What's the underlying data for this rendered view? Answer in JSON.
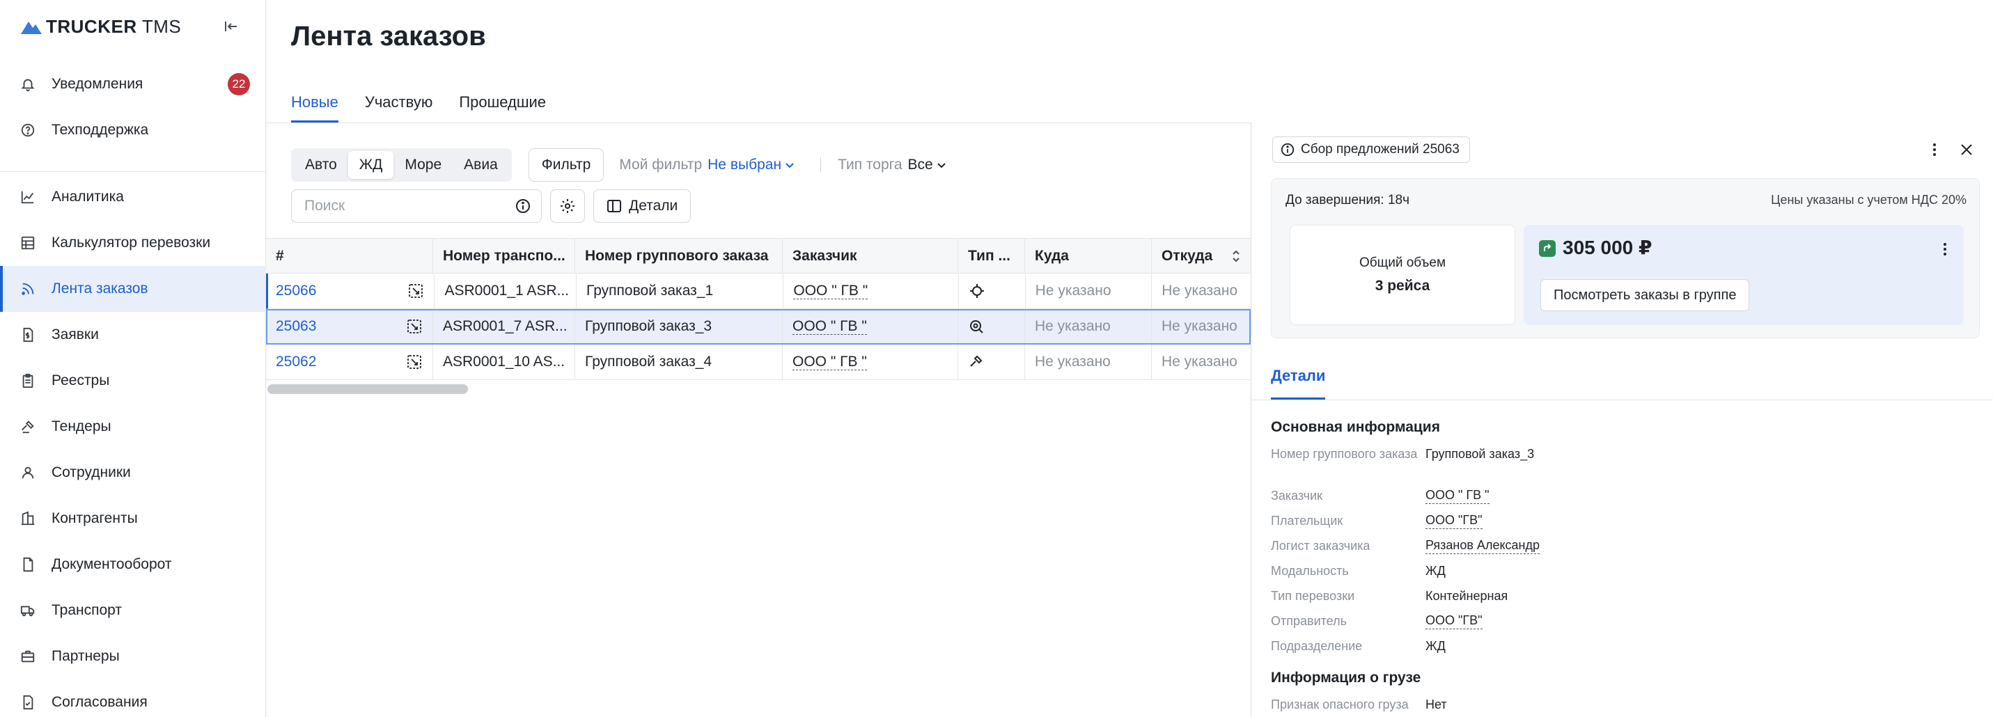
{
  "brand": {
    "name_bold": "TRUCKER",
    "name_light": " TMS"
  },
  "sidebar": {
    "top_items": [
      {
        "label": "Уведомления",
        "icon": "bell-icon",
        "badge": "22"
      },
      {
        "label": "Техподдержка",
        "icon": "help-circle-icon"
      }
    ],
    "items": [
      {
        "label": "Аналитика",
        "icon": "chart-line-icon"
      },
      {
        "label": "Калькулятор перевозки",
        "icon": "calculator-icon"
      },
      {
        "label": "Лента заказов",
        "icon": "rss-icon",
        "active": true
      },
      {
        "label": "Заявки",
        "icon": "document-dollar-icon"
      },
      {
        "label": "Реестры",
        "icon": "clipboard-list-icon"
      },
      {
        "label": "Тендеры",
        "icon": "gavel-icon"
      },
      {
        "label": "Сотрудники",
        "icon": "user-icon"
      },
      {
        "label": "Контрагенты",
        "icon": "building-icon"
      },
      {
        "label": "Документооборот",
        "icon": "document-icon"
      },
      {
        "label": "Транспорт",
        "icon": "truck-icon"
      },
      {
        "label": "Партнеры",
        "icon": "briefcase-icon"
      },
      {
        "label": "Согласования",
        "icon": "file-check-icon"
      }
    ]
  },
  "page": {
    "title": "Лента заказов",
    "tabs": [
      {
        "label": "Новые",
        "active": true
      },
      {
        "label": "Участвую"
      },
      {
        "label": "Прошедшие"
      }
    ]
  },
  "filters": {
    "modes": [
      "Авто",
      "ЖД",
      "Море",
      "Авиа"
    ],
    "active_mode": "ЖД",
    "filter_label": "Фильтр",
    "my_filter_label": "Мой фильтр",
    "my_filter_value": "Не выбран",
    "trade_type_label": "Тип торга",
    "trade_type_value": "Все",
    "search_placeholder": "Поиск",
    "details_label": "Детали"
  },
  "table": {
    "columns": [
      "#",
      "Номер транспо...",
      "Номер группового заказа",
      "Заказчик",
      "Тип ...",
      "Куда",
      "Откуда"
    ],
    "rows": [
      {
        "id": "25066",
        "transport": "ASR0001_1 ASR...",
        "group": "Групповой заказ_1",
        "customer": "ООО \" ГВ \"",
        "type_icon": "crosshair-icon",
        "to": "Не указано",
        "from": "Не указано"
      },
      {
        "id": "25063",
        "transport": "ASR0001_7 ASR...",
        "group": "Групповой заказ_3",
        "customer": "ООО \" ГВ \"",
        "type_icon": "search-zoom-icon",
        "to": "Не указано",
        "from": "Не указано",
        "selected": true
      },
      {
        "id": "25062",
        "transport": "ASR0001_10 AS...",
        "group": "Групповой заказ_4",
        "customer": "ООО \" ГВ \"",
        "type_icon": "gavel-icon",
        "to": "Не указано",
        "from": "Не указано"
      }
    ]
  },
  "detail": {
    "header": "Сбор предложений 25063",
    "deadline": "До завершения: 18ч",
    "vat_note": "Цены указаны с учетом НДС 20%",
    "volume_label": "Общий объем",
    "volume_value": "3 рейса",
    "price": "305 000 ₽",
    "view_orders": "Посмотреть заказы в группе",
    "tab": "Детали",
    "main_info_title": "Основная информация",
    "main_info": [
      {
        "k": "Номер группового заказа",
        "v": "Групповой заказ_3"
      },
      {
        "k": "Заказчик",
        "v": "ООО \" ГВ \"",
        "link": true
      },
      {
        "k": "Плательщик",
        "v": "ООО \"ГВ\"",
        "link": true
      },
      {
        "k": "Логист заказчика",
        "v": "Рязанов Александр",
        "link": true
      },
      {
        "k": "Модальность",
        "v": "ЖД"
      },
      {
        "k": "Тип перевозки",
        "v": "Контейнерная"
      },
      {
        "k": "Отправитель",
        "v": "ООО \"ГВ\"",
        "link": true
      },
      {
        "k": "Подразделение",
        "v": "ЖД"
      }
    ],
    "cargo_title": "Информация о грузе",
    "cargo": [
      {
        "k": "Признак опасного груза",
        "v": "Нет"
      }
    ]
  },
  "colors": {
    "accent": "#1f5fcf",
    "badge": "#c4323a",
    "price_icon": "#2e8b57"
  }
}
